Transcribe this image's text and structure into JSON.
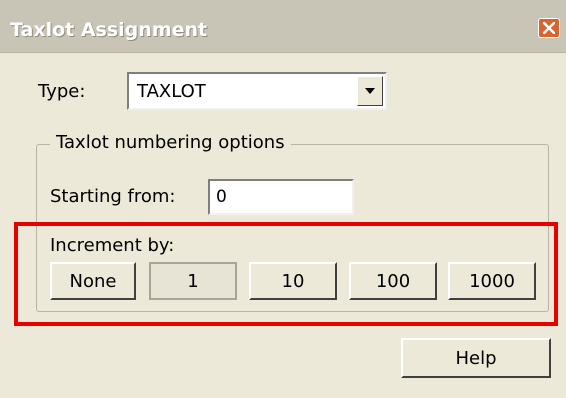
{
  "window": {
    "title": "Taxlot Assignment",
    "close_icon": "close-icon"
  },
  "type_field": {
    "label": "Type:",
    "value": "TAXLOT",
    "dropdown_icon": "chevron-down-icon"
  },
  "numbering_group": {
    "legend": "Taxlot numbering options",
    "starting_from_label": "Starting from:",
    "starting_from_value": "0",
    "increment_label": "Increment by:",
    "increment_options": [
      "None",
      "1",
      "10",
      "100",
      "1000"
    ],
    "selected_increment": "1"
  },
  "help_button": "Help",
  "colors": {
    "dialog_bg": "#ece9d8",
    "highlight": "#e60000",
    "close_button": "#d8642f"
  }
}
